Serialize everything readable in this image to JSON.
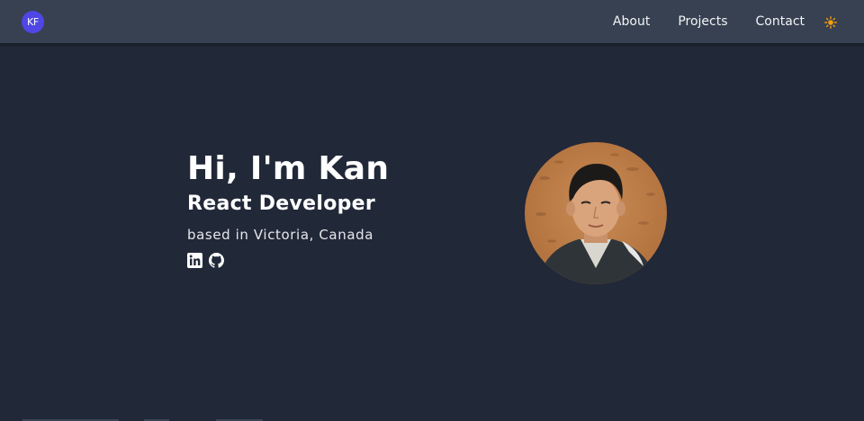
{
  "header": {
    "logo_text": "KF",
    "nav": [
      {
        "label": "About"
      },
      {
        "label": "Projects"
      },
      {
        "label": "Contact"
      }
    ],
    "theme_icon": "sun-icon"
  },
  "hero": {
    "greeting": "Hi, I'm Kan",
    "role": "React Developer",
    "location": "based in Victoria, Canada",
    "socials": [
      {
        "icon": "linkedin-icon"
      },
      {
        "icon": "github-icon"
      }
    ],
    "avatar_icon": "profile-photo"
  },
  "colors": {
    "nav_bg": "#374151",
    "page_bg": "#212838",
    "logo_bg": "#4f46e5",
    "sun": "#f59e0b",
    "text": "#ffffff"
  }
}
